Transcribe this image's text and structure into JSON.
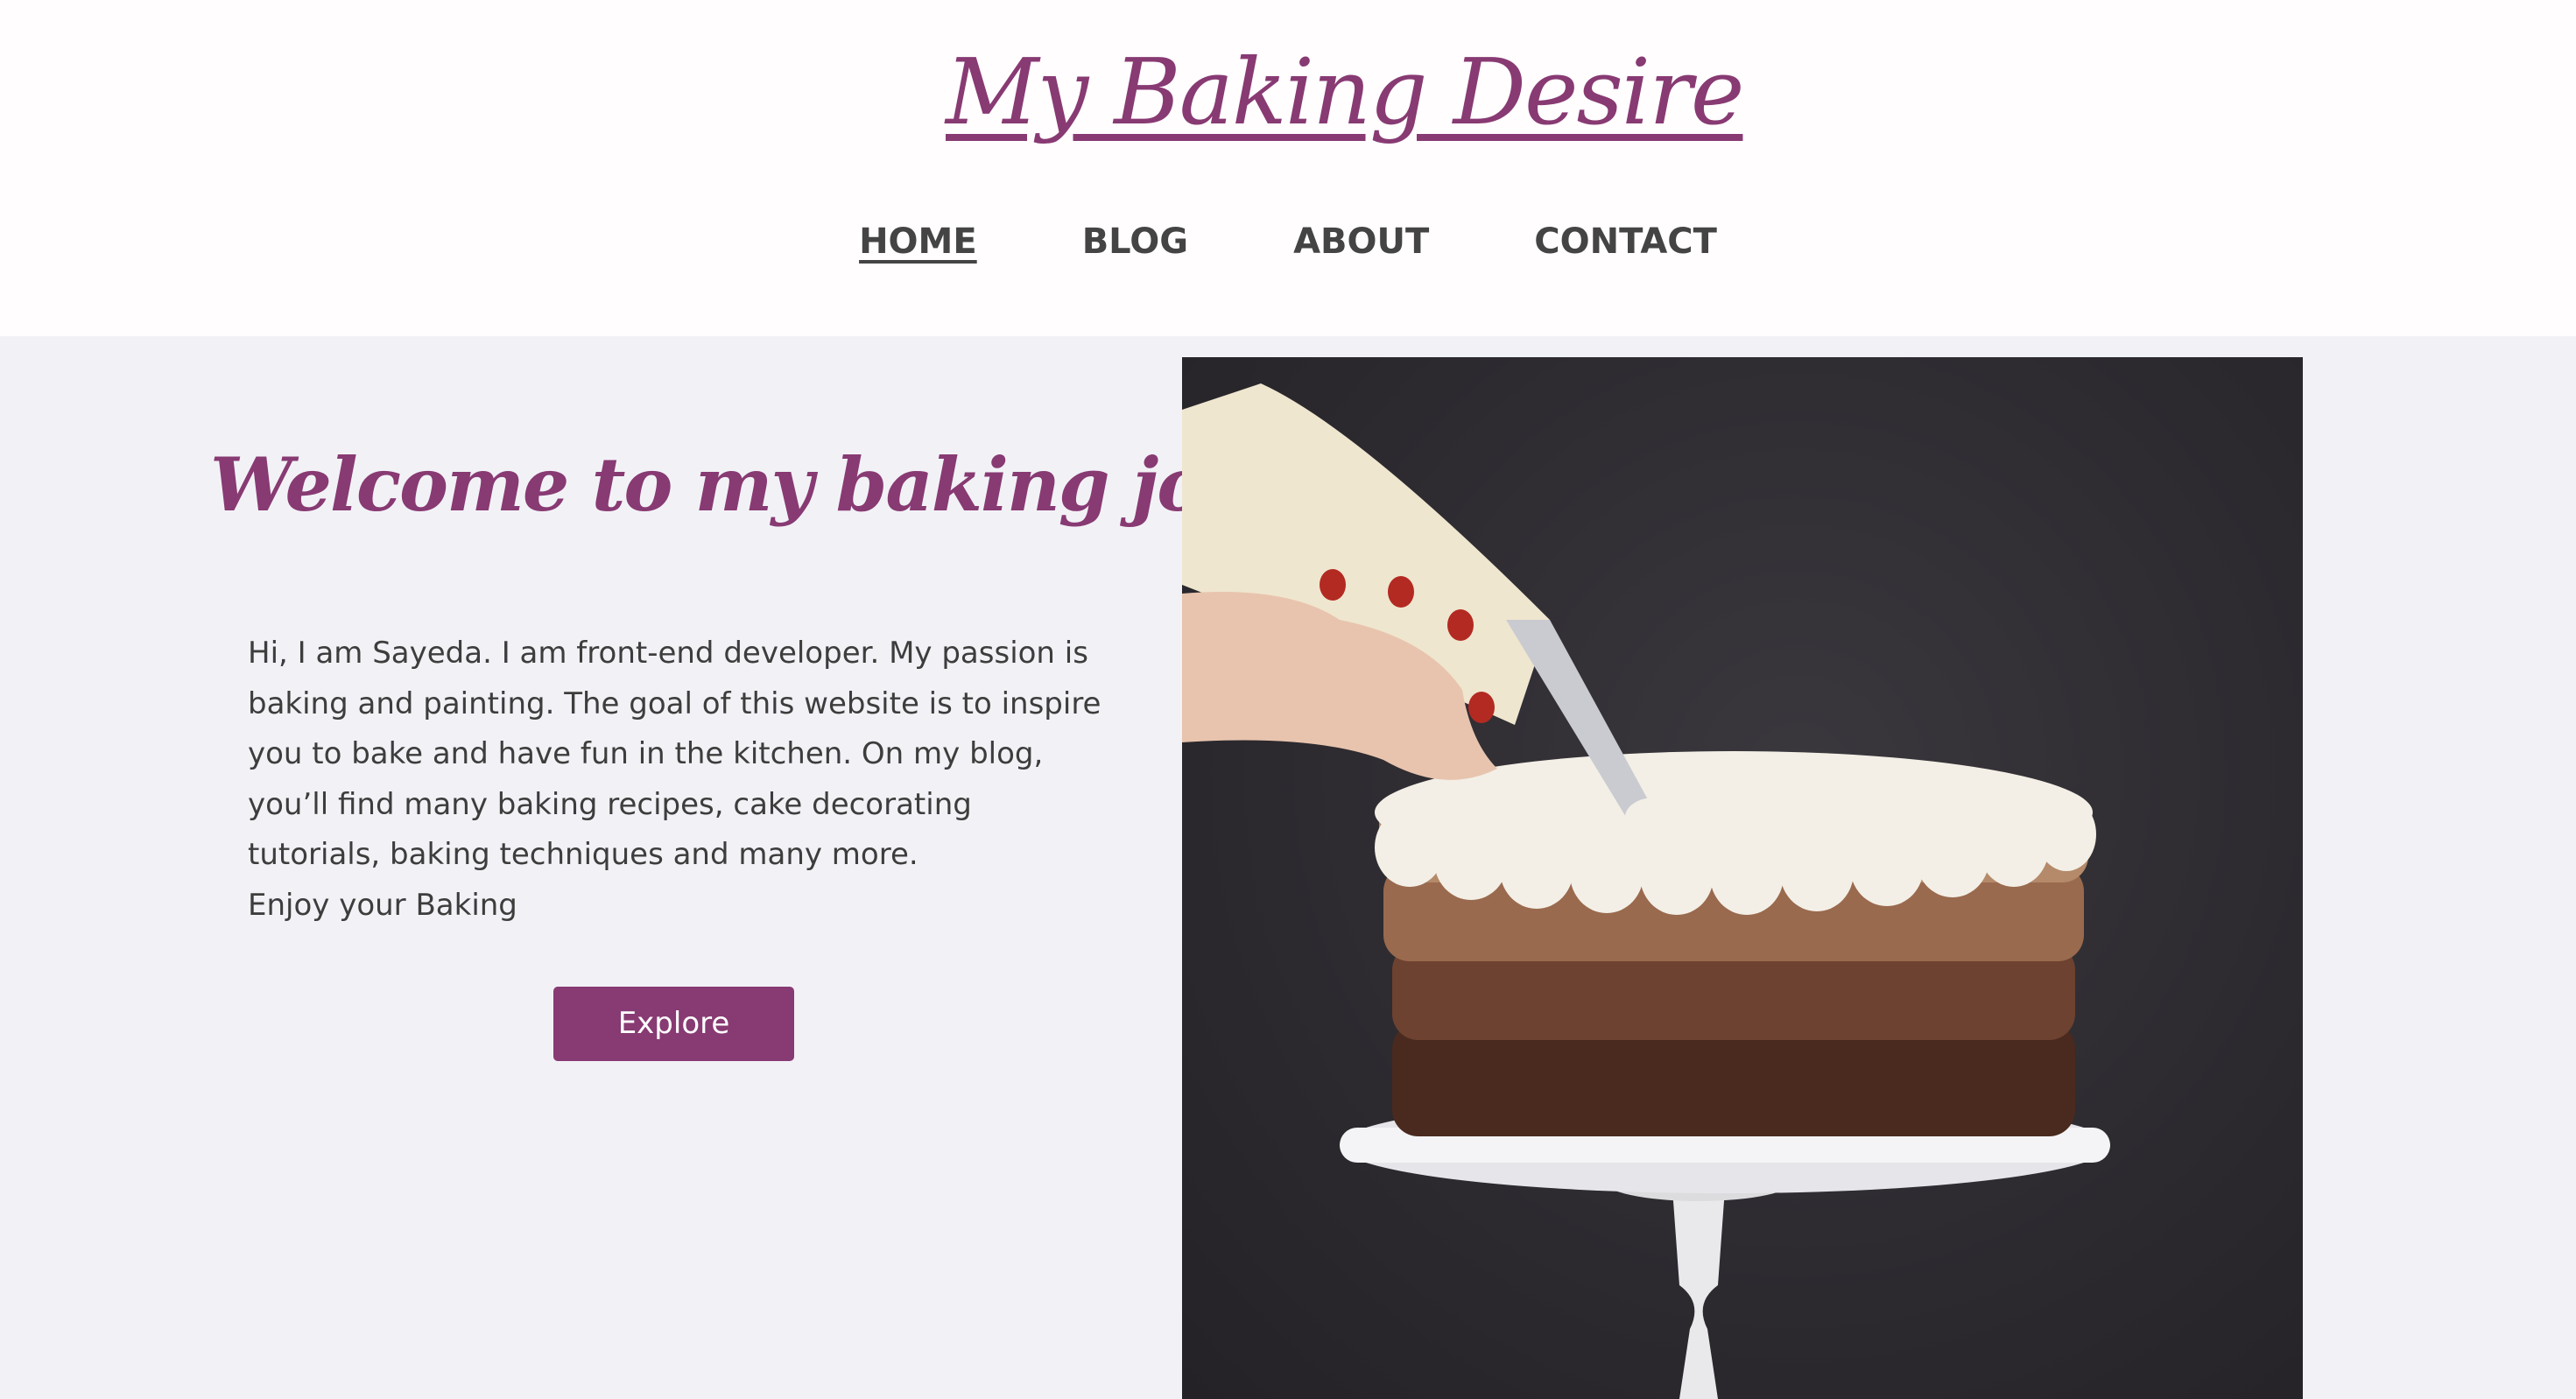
{
  "header": {
    "site_title": "My Baking Desire"
  },
  "nav": {
    "items": [
      {
        "label": "HOME",
        "active": true
      },
      {
        "label": "BLOG",
        "active": false
      },
      {
        "label": "ABOUT",
        "active": false
      },
      {
        "label": "CONTACT",
        "active": false
      }
    ]
  },
  "hero": {
    "heading": "Welcome to my baking journal",
    "intro_lines": [
      "Hi, I am Sayeda. I am front-end developer. My passion is",
      "baking and painting. The goal of this website is to inspire",
      "you to bake and have fun in the kitchen. On my blog,",
      "you’ll find many baking recipes, cake decorating",
      "tutorials, baking techniques and many more.",
      "Enjoy your Baking"
    ],
    "explore_label": "Explore",
    "image_icon": "cake-photo"
  },
  "colors": {
    "brand": "#883a73",
    "header_bg": "#fffdfe",
    "hero_bg": "#f2f2f6",
    "nav_text": "#444444",
    "photo_bg": "#2c2a2f"
  }
}
